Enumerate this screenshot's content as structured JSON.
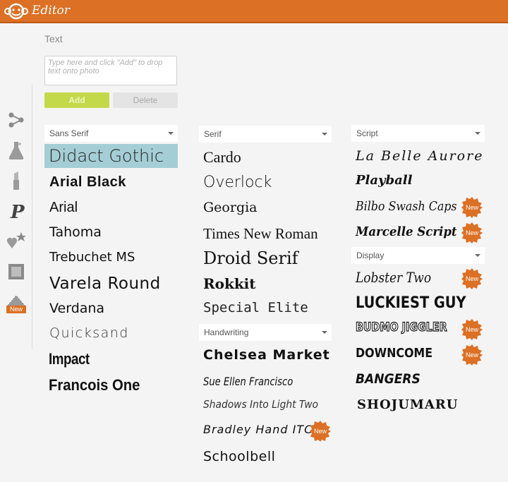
{
  "app": {
    "title": "Editor"
  },
  "colors": {
    "brand": "#dc7024",
    "add_button": "#c4d94a",
    "selected_row": "#a4cdd5",
    "badge": "#dc7024"
  },
  "toolbar": {
    "tools": [
      {
        "icon": "share-network-icon"
      },
      {
        "icon": "flask-icon"
      },
      {
        "icon": "lipstick-icon"
      },
      {
        "icon": "text-p-icon"
      },
      {
        "icon": "stickers-icon"
      },
      {
        "icon": "frame-icon"
      },
      {
        "icon": "texture-icon",
        "badge": "New"
      }
    ]
  },
  "text_panel": {
    "label": "Text",
    "placeholder": "Type here and click \"Add\" to drop text onto photo",
    "add_label": "Add",
    "delete_label": "Delete"
  },
  "categories": {
    "sans_serif": "Sans Serif",
    "serif": "Serif",
    "script": "Script",
    "handwriting": "Handwriting",
    "display": "Display"
  },
  "fonts": {
    "sans_serif": [
      "Didact Gothic",
      "Arial Black",
      "Arial",
      "Tahoma",
      "Trebuchet MS",
      "Varela Round",
      "Verdana",
      "Quicksand",
      "Impact",
      "Francois One"
    ],
    "serif": [
      "Cardo",
      "Overlock",
      "Georgia",
      "Times New Roman",
      "Droid Serif",
      "Rokkit",
      "Special Elite"
    ],
    "handwriting": [
      "Chelsea Market",
      "Sue Ellen Francisco",
      "Shadows Into Light Two",
      "Bradley Hand ITC",
      "Schoolbell"
    ],
    "script": [
      "La Belle Aurore",
      "Playball",
      "Bilbo Swash Caps",
      "Marcelle Script"
    ],
    "display": [
      "Lobster Two",
      "LUCKIEST GUY",
      "BUDMO JIGGLER",
      "DOWNCOME",
      "BANGERS",
      "SHOJUMARU"
    ]
  },
  "selected_font": "Didact Gothic",
  "badge_label": "New"
}
